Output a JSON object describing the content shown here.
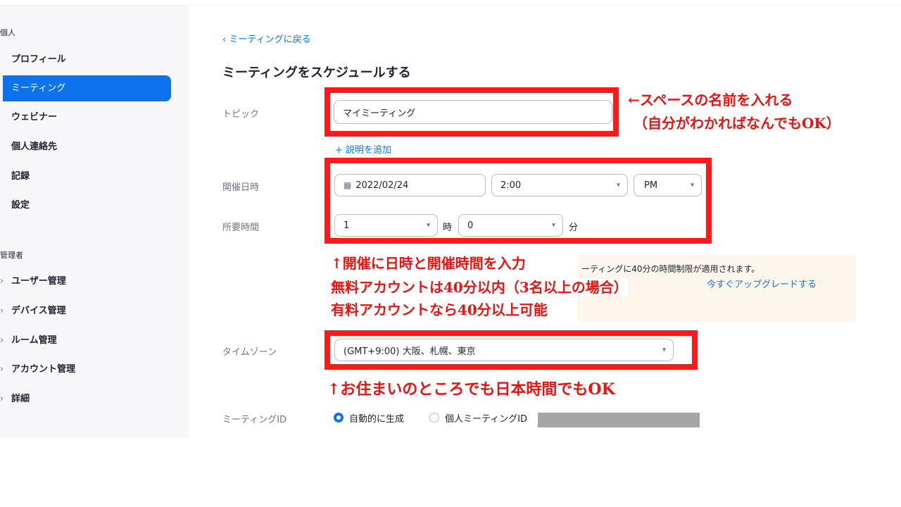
{
  "sidebar": {
    "personal_label": "個人",
    "items": [
      {
        "label": "プロフィール"
      },
      {
        "label": "ミーティング"
      },
      {
        "label": "ウェビナー"
      },
      {
        "label": "個人連絡先"
      },
      {
        "label": "記録"
      },
      {
        "label": "設定"
      }
    ],
    "admin_label": "管理者",
    "admin_items": [
      {
        "label": "ユーザー管理"
      },
      {
        "label": "デバイス管理"
      },
      {
        "label": "ルーム管理"
      },
      {
        "label": "アカウント管理"
      },
      {
        "label": "詳細"
      }
    ]
  },
  "main": {
    "back_link": "ミーティングに戻る",
    "title": "ミーティングをスケジュールする",
    "topic_label": "トピック",
    "topic_value": "マイミーティング",
    "add_description": "説明を追加",
    "when_label": "開催日時",
    "date_value": "2022/02/24",
    "time_value": "2:00",
    "ampm_value": "PM",
    "duration_label": "所要時間",
    "duration_hours": "1",
    "hours_unit": "時",
    "duration_minutes": "0",
    "minutes_unit": "分",
    "notice_text": "ーティングに40分の時間制限が適用されます。",
    "upgrade_link": "今すぐアップグレードする",
    "timezone_label": "タイムゾーン",
    "timezone_value": "(GMT+9:00) 大阪、札幌、東京",
    "meeting_id_label": "ミーティングID",
    "meeting_id_auto": "自動的に生成",
    "meeting_id_personal": "個人ミーティングID"
  },
  "annotations": {
    "topic_line1": "←スペースの名前を入れる",
    "topic_line2": "（自分がわかればなんでもOK）",
    "time_line1": "↑開催に日時と開催時間を入力",
    "time_line2": "無料アカウントは40分以内（3名以上の場合）",
    "time_line3": "有料アカウントなら40分以上可能",
    "timezone_note": "↑お住まいのところでも日本時間でもOK"
  },
  "colors": {
    "accent": "#0e72ed",
    "annotation_red": "#ff1a1a",
    "sidebar_bg": "#f7f7fa",
    "notice_bg": "#fdf6ec"
  }
}
